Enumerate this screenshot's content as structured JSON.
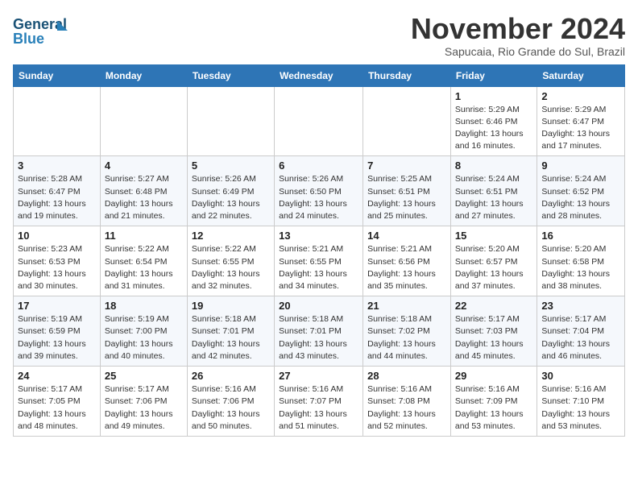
{
  "logo": {
    "line1": "General",
    "line2": "Blue"
  },
  "header": {
    "month": "November 2024",
    "location": "Sapucaia, Rio Grande do Sul, Brazil"
  },
  "weekdays": [
    "Sunday",
    "Monday",
    "Tuesday",
    "Wednesday",
    "Thursday",
    "Friday",
    "Saturday"
  ],
  "weeks": [
    [
      {
        "day": "",
        "info": ""
      },
      {
        "day": "",
        "info": ""
      },
      {
        "day": "",
        "info": ""
      },
      {
        "day": "",
        "info": ""
      },
      {
        "day": "",
        "info": ""
      },
      {
        "day": "1",
        "info": "Sunrise: 5:29 AM\nSunset: 6:46 PM\nDaylight: 13 hours and 16 minutes."
      },
      {
        "day": "2",
        "info": "Sunrise: 5:29 AM\nSunset: 6:47 PM\nDaylight: 13 hours and 17 minutes."
      }
    ],
    [
      {
        "day": "3",
        "info": "Sunrise: 5:28 AM\nSunset: 6:47 PM\nDaylight: 13 hours and 19 minutes."
      },
      {
        "day": "4",
        "info": "Sunrise: 5:27 AM\nSunset: 6:48 PM\nDaylight: 13 hours and 21 minutes."
      },
      {
        "day": "5",
        "info": "Sunrise: 5:26 AM\nSunset: 6:49 PM\nDaylight: 13 hours and 22 minutes."
      },
      {
        "day": "6",
        "info": "Sunrise: 5:26 AM\nSunset: 6:50 PM\nDaylight: 13 hours and 24 minutes."
      },
      {
        "day": "7",
        "info": "Sunrise: 5:25 AM\nSunset: 6:51 PM\nDaylight: 13 hours and 25 minutes."
      },
      {
        "day": "8",
        "info": "Sunrise: 5:24 AM\nSunset: 6:51 PM\nDaylight: 13 hours and 27 minutes."
      },
      {
        "day": "9",
        "info": "Sunrise: 5:24 AM\nSunset: 6:52 PM\nDaylight: 13 hours and 28 minutes."
      }
    ],
    [
      {
        "day": "10",
        "info": "Sunrise: 5:23 AM\nSunset: 6:53 PM\nDaylight: 13 hours and 30 minutes."
      },
      {
        "day": "11",
        "info": "Sunrise: 5:22 AM\nSunset: 6:54 PM\nDaylight: 13 hours and 31 minutes."
      },
      {
        "day": "12",
        "info": "Sunrise: 5:22 AM\nSunset: 6:55 PM\nDaylight: 13 hours and 32 minutes."
      },
      {
        "day": "13",
        "info": "Sunrise: 5:21 AM\nSunset: 6:55 PM\nDaylight: 13 hours and 34 minutes."
      },
      {
        "day": "14",
        "info": "Sunrise: 5:21 AM\nSunset: 6:56 PM\nDaylight: 13 hours and 35 minutes."
      },
      {
        "day": "15",
        "info": "Sunrise: 5:20 AM\nSunset: 6:57 PM\nDaylight: 13 hours and 37 minutes."
      },
      {
        "day": "16",
        "info": "Sunrise: 5:20 AM\nSunset: 6:58 PM\nDaylight: 13 hours and 38 minutes."
      }
    ],
    [
      {
        "day": "17",
        "info": "Sunrise: 5:19 AM\nSunset: 6:59 PM\nDaylight: 13 hours and 39 minutes."
      },
      {
        "day": "18",
        "info": "Sunrise: 5:19 AM\nSunset: 7:00 PM\nDaylight: 13 hours and 40 minutes."
      },
      {
        "day": "19",
        "info": "Sunrise: 5:18 AM\nSunset: 7:01 PM\nDaylight: 13 hours and 42 minutes."
      },
      {
        "day": "20",
        "info": "Sunrise: 5:18 AM\nSunset: 7:01 PM\nDaylight: 13 hours and 43 minutes."
      },
      {
        "day": "21",
        "info": "Sunrise: 5:18 AM\nSunset: 7:02 PM\nDaylight: 13 hours and 44 minutes."
      },
      {
        "day": "22",
        "info": "Sunrise: 5:17 AM\nSunset: 7:03 PM\nDaylight: 13 hours and 45 minutes."
      },
      {
        "day": "23",
        "info": "Sunrise: 5:17 AM\nSunset: 7:04 PM\nDaylight: 13 hours and 46 minutes."
      }
    ],
    [
      {
        "day": "24",
        "info": "Sunrise: 5:17 AM\nSunset: 7:05 PM\nDaylight: 13 hours and 48 minutes."
      },
      {
        "day": "25",
        "info": "Sunrise: 5:17 AM\nSunset: 7:06 PM\nDaylight: 13 hours and 49 minutes."
      },
      {
        "day": "26",
        "info": "Sunrise: 5:16 AM\nSunset: 7:06 PM\nDaylight: 13 hours and 50 minutes."
      },
      {
        "day": "27",
        "info": "Sunrise: 5:16 AM\nSunset: 7:07 PM\nDaylight: 13 hours and 51 minutes."
      },
      {
        "day": "28",
        "info": "Sunrise: 5:16 AM\nSunset: 7:08 PM\nDaylight: 13 hours and 52 minutes."
      },
      {
        "day": "29",
        "info": "Sunrise: 5:16 AM\nSunset: 7:09 PM\nDaylight: 13 hours and 53 minutes."
      },
      {
        "day": "30",
        "info": "Sunrise: 5:16 AM\nSunset: 7:10 PM\nDaylight: 13 hours and 53 minutes."
      }
    ]
  ]
}
